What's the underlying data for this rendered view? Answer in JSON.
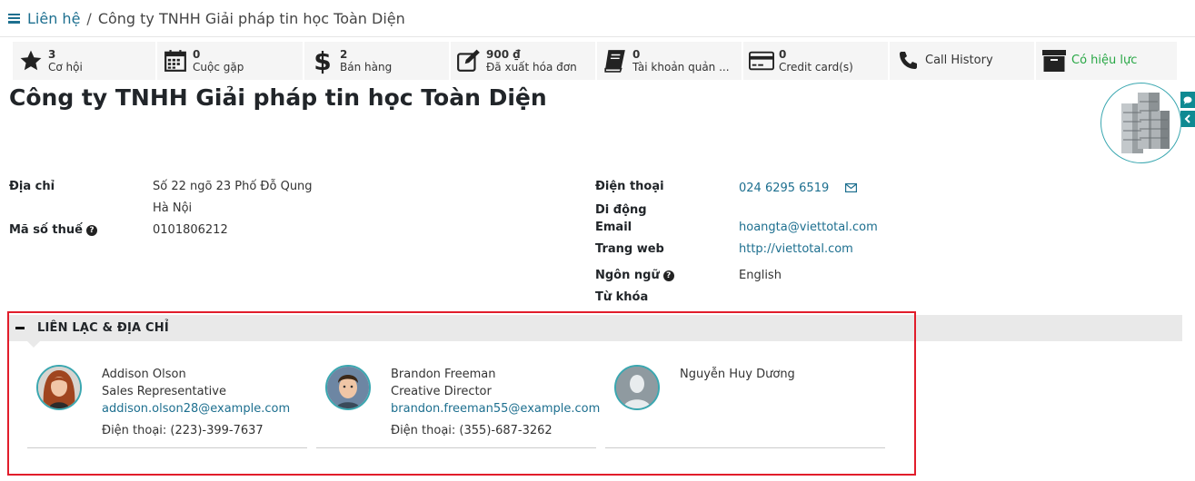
{
  "breadcrumb": {
    "parent": "Liên hệ",
    "separator": "/",
    "current": "Công ty TNHH Giải pháp tin học Toàn Diện"
  },
  "stats": [
    {
      "icon": "star-icon",
      "value": "3",
      "label": "Cơ hội"
    },
    {
      "icon": "calendar-icon",
      "value": "0",
      "label": "Cuộc gặp"
    },
    {
      "icon": "dollar-icon",
      "value": "2",
      "label": "Bán hàng"
    },
    {
      "icon": "edit-icon",
      "value": "900 ₫",
      "label": "Đã xuất hóa đơn"
    },
    {
      "icon": "book-icon",
      "value": "0",
      "label": "Tài khoản quản ..."
    },
    {
      "icon": "credit-card-icon",
      "value": "0",
      "label": "Credit card(s)"
    },
    {
      "icon": "phone-icon",
      "label": "Call History"
    },
    {
      "icon": "archive-icon",
      "label": "Có hiệu lực"
    }
  ],
  "partner": {
    "name": "Công ty TNHH Giải pháp tin học Toàn Diện"
  },
  "fields": {
    "address_label": "Địa chỉ",
    "address_line1": "Số 22 ngõ 23 Phố Đỗ Qung",
    "address_line2": "Hà Nội",
    "tax_label": "Mã số thuế",
    "tax_value": "0101806212",
    "phone_label": "Điện thoại",
    "phone_value": "024 6295 6519",
    "mobile_label": "Di động",
    "email_label": "Email",
    "email_value": "hoangta@viettotal.com",
    "website_label": "Trang web",
    "website_value": "http://viettotal.com",
    "language_label": "Ngôn ngữ",
    "language_value": "English",
    "tags_label": "Từ khóa"
  },
  "section": {
    "title": "LIÊN LẠC & ĐỊA CHỈ"
  },
  "contacts": [
    {
      "name": "Addison Olson",
      "role": "Sales Representative",
      "email": "addison.olson28@example.com",
      "phone": "Điện thoại: (223)-399-7637"
    },
    {
      "name": "Brandon Freeman",
      "role": "Creative Director",
      "email": "brandon.freeman55@example.com",
      "phone": "Điện thoại: (355)-687-3262"
    },
    {
      "name": "Nguyễn Huy Dương"
    }
  ],
  "colors": {
    "link": "#1d6f8f",
    "accent": "#0f8a92",
    "active": "#28a745",
    "highlight": "#e11d2b"
  }
}
